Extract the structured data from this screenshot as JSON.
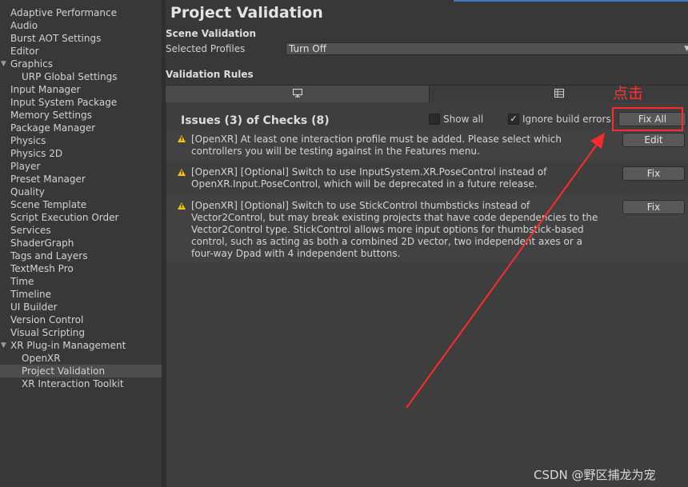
{
  "sidebar": {
    "items": [
      {
        "label": "Adaptive Performance",
        "level": 0
      },
      {
        "label": "Audio",
        "level": 0
      },
      {
        "label": "Burst AOT Settings",
        "level": 0
      },
      {
        "label": "Editor",
        "level": 0
      },
      {
        "label": "Graphics",
        "level": 0,
        "expanded": true
      },
      {
        "label": "URP Global Settings",
        "level": 1
      },
      {
        "label": "Input Manager",
        "level": 0
      },
      {
        "label": "Input System Package",
        "level": 0
      },
      {
        "label": "Memory Settings",
        "level": 0
      },
      {
        "label": "Package Manager",
        "level": 0
      },
      {
        "label": "Physics",
        "level": 0
      },
      {
        "label": "Physics 2D",
        "level": 0
      },
      {
        "label": "Player",
        "level": 0
      },
      {
        "label": "Preset Manager",
        "level": 0
      },
      {
        "label": "Quality",
        "level": 0
      },
      {
        "label": "Scene Template",
        "level": 0
      },
      {
        "label": "Script Execution Order",
        "level": 0
      },
      {
        "label": "Services",
        "level": 0
      },
      {
        "label": "ShaderGraph",
        "level": 0
      },
      {
        "label": "Tags and Layers",
        "level": 0
      },
      {
        "label": "TextMesh Pro",
        "level": 0
      },
      {
        "label": "Time",
        "level": 0
      },
      {
        "label": "Timeline",
        "level": 0
      },
      {
        "label": "UI Builder",
        "level": 0
      },
      {
        "label": "Version Control",
        "level": 0
      },
      {
        "label": "Visual Scripting",
        "level": 0
      },
      {
        "label": "XR Plug-in Management",
        "level": 0,
        "expanded": true
      },
      {
        "label": "OpenXR",
        "level": 1
      },
      {
        "label": "Project Validation",
        "level": 1,
        "selected": true
      },
      {
        "label": "XR Interaction Toolkit",
        "level": 1
      }
    ]
  },
  "main": {
    "title": "Project Validation",
    "scene_validation": {
      "heading": "Scene Validation",
      "profiles_label": "Selected Profiles",
      "profiles_value": "Turn Off"
    },
    "rules_heading": "Validation Rules",
    "tabs": [
      {
        "icon": "monitor-icon",
        "active": true
      },
      {
        "icon": "grid-icon",
        "active": false
      }
    ],
    "issues": {
      "title": "Issues (3) of Checks (8)",
      "show_all_label": "Show all",
      "show_all_checked": false,
      "ignore_label": "Ignore build errors",
      "ignore_checked": true,
      "fix_all_label": "Fix All",
      "rows": [
        {
          "text": "[OpenXR] At least one interaction profile must be added.  Please select which controllers you will be testing against in the Features menu.",
          "button": "Edit"
        },
        {
          "text": "[OpenXR] [Optional] Switch to use InputSystem.XR.PoseControl instead of OpenXR.Input.PoseControl, which will be deprecated in a future release.",
          "button": "Fix"
        },
        {
          "text": "[OpenXR] [Optional] Switch to use StickControl thumbsticks instead of Vector2Control, but may break existing projects that have code dependencies to the Vector2Control type. StickControl allows more input options for thumbstick-based control, such as acting as both a combined 2D vector, two independent axes or a four-way Dpad with 4 independent buttons.",
          "button": "Fix"
        }
      ]
    }
  },
  "annotation": {
    "label": "点击",
    "color": "#ff2a2a"
  },
  "watermark": "CSDN @野区捕龙为宠",
  "colors": {
    "warning": "#f4c31b",
    "accent": "#3a79bb"
  }
}
